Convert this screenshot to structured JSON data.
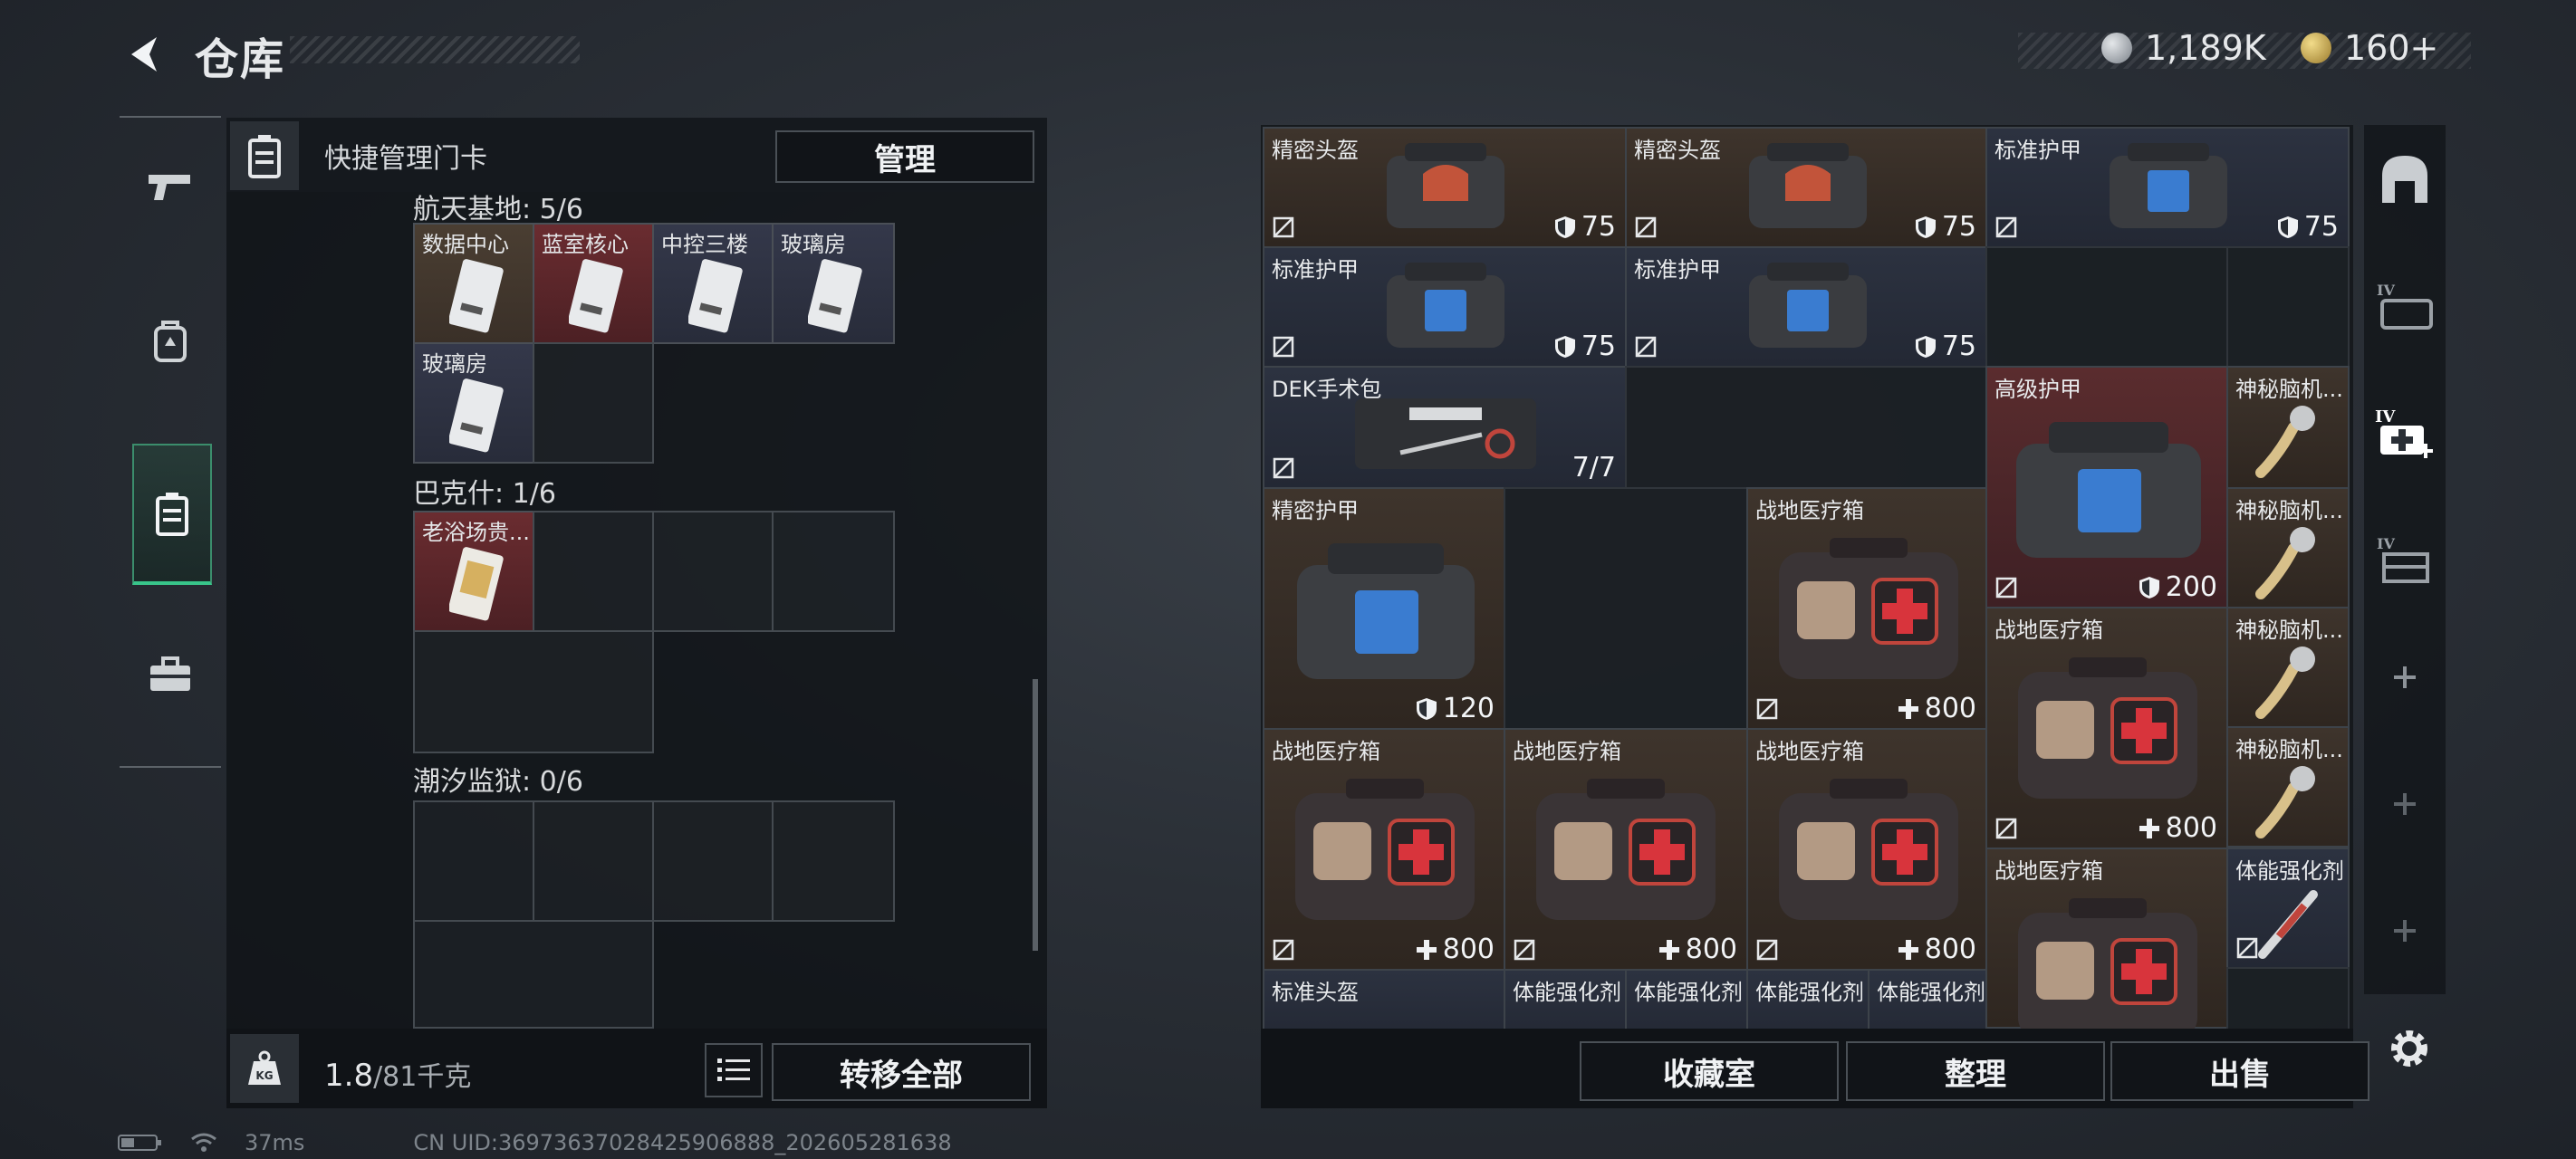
{
  "header": {
    "title": "仓库",
    "currency1": "1,189K",
    "currency2": "160+"
  },
  "left_panel": {
    "title": "快捷管理门卡",
    "manage_label": "管理",
    "sections": [
      {
        "title": "航天基地: 5/6",
        "cards": [
          "数据中心",
          "蓝室核心",
          "中控三楼",
          "玻璃房",
          "玻璃房"
        ]
      },
      {
        "title": "巴克什: 1/6",
        "cards": [
          "老浴场贵..."
        ]
      },
      {
        "title": "潮汐监狱: 0/6",
        "cards": []
      }
    ],
    "weight_current": "1.8",
    "weight_total": "/81千克",
    "transfer_all_label": "转移全部"
  },
  "stash": {
    "items": [
      {
        "name": "精密头盔",
        "value": "75"
      },
      {
        "name": "精密头盔",
        "value": "75"
      },
      {
        "name": "标准护甲",
        "value": "75"
      },
      {
        "name": "标准护甲",
        "value": "75"
      },
      {
        "name": "标准护甲",
        "value": "75"
      },
      {
        "name": "DEK手术包",
        "value": "7/7"
      },
      {
        "name": "高级护甲",
        "value": "200"
      },
      {
        "name": "神秘脑机...",
        "value": ""
      },
      {
        "name": "神秘脑机...",
        "value": ""
      },
      {
        "name": "神秘脑机...",
        "value": ""
      },
      {
        "name": "神秘脑机...",
        "value": ""
      },
      {
        "name": "精密护甲",
        "value": "120"
      },
      {
        "name": "战地医疗箱",
        "value": "800"
      },
      {
        "name": "战地医疗箱",
        "value": "800"
      },
      {
        "name": "战地医疗箱",
        "value": "800"
      },
      {
        "name": "战地医疗箱",
        "value": "800"
      },
      {
        "name": "战地医疗箱",
        "value": "800"
      },
      {
        "name": "战地医疗箱",
        "value": ""
      },
      {
        "name": "体能强化剂",
        "value": ""
      },
      {
        "name": "标准头盔",
        "value": ""
      },
      {
        "name": "体能强化剂",
        "value": ""
      },
      {
        "name": "体能强化剂",
        "value": ""
      },
      {
        "name": "体能强化剂",
        "value": ""
      },
      {
        "name": "体能强化剂",
        "value": ""
      }
    ],
    "buttons": {
      "collection": "收藏室",
      "sort": "整理",
      "sell": "出售"
    }
  },
  "status": {
    "ping": "37ms",
    "uid": "CN UID:36973637028425906888_202605281638"
  },
  "icons": {
    "back": "back-arrow-icon",
    "coin1": "silver-coin-icon",
    "coin2": "gold-coin-icon",
    "nav": [
      "pistol-icon",
      "backpack-icon",
      "keycard-holder-icon",
      "toolbox-icon"
    ],
    "right_nav": [
      "helmet-shelf-icon",
      "tier4-armor-icon",
      "tier4-medkit-icon",
      "tier4-storage-icon",
      "plus-icon",
      "plus-icon",
      "plus-icon"
    ],
    "settings": "gear-icon"
  },
  "colors": {
    "accent_green": "#38c58a",
    "slot_brown": "#3e342c",
    "slot_blue": "#2c3240",
    "slot_red": "#5a2c2e"
  }
}
